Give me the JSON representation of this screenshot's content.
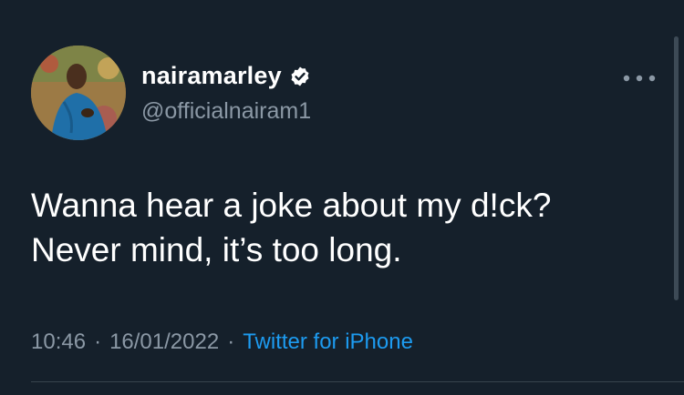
{
  "author": {
    "display_name": "nairamarley",
    "handle": "@officialnairam1",
    "verified": true
  },
  "tweet": {
    "text": "Wanna hear a joke about my d!ck?\nNever mind, it’s too long."
  },
  "meta": {
    "time": "10:46",
    "separator": "·",
    "date": "16/01/2022",
    "source": "Twitter for iPhone"
  },
  "icons": {
    "verified": "verified-badge-icon",
    "more": "more-options-icon"
  },
  "colors": {
    "background": "#15202b",
    "text_primary": "#ffffff",
    "text_secondary": "#8b98a5",
    "link": "#1d9bf0"
  }
}
